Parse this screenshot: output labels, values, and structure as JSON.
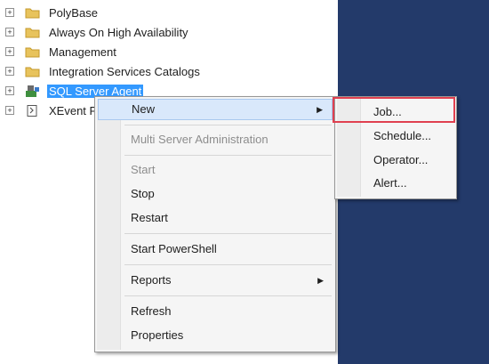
{
  "object_explorer": {
    "items": [
      {
        "label": "PolyBase",
        "icon": "folder-icon",
        "expanded": false
      },
      {
        "label": "Always On High Availability",
        "icon": "folder-icon",
        "expanded": false
      },
      {
        "label": "Management",
        "icon": "folder-icon",
        "expanded": false
      },
      {
        "label": "Integration Services Catalogs",
        "icon": "folder-icon",
        "expanded": false
      },
      {
        "label": "SQL Server Agent",
        "icon": "sql-agent-icon",
        "expanded": false,
        "selected": true
      },
      {
        "label": "XEvent P",
        "icon": "xevent-profiler-icon",
        "expanded": false
      }
    ]
  },
  "context_menu": {
    "items": [
      {
        "label": "New",
        "has_submenu": true,
        "highlighted": true
      },
      {
        "label": "Multi Server Administration",
        "disabled": true
      },
      {
        "label": "Start",
        "disabled": true
      },
      {
        "label": "Stop"
      },
      {
        "label": "Restart"
      },
      {
        "label": "Start PowerShell"
      },
      {
        "label": "Reports",
        "has_submenu": true
      },
      {
        "label": "Refresh"
      },
      {
        "label": "Properties"
      }
    ]
  },
  "new_submenu": {
    "items": [
      {
        "label": "Job...",
        "outlined": true
      },
      {
        "label": "Schedule..."
      },
      {
        "label": "Operator..."
      },
      {
        "label": "Alert..."
      }
    ]
  },
  "colors": {
    "selection": "#3399ff",
    "outline": "#e04050",
    "panel": "#233a6a"
  }
}
